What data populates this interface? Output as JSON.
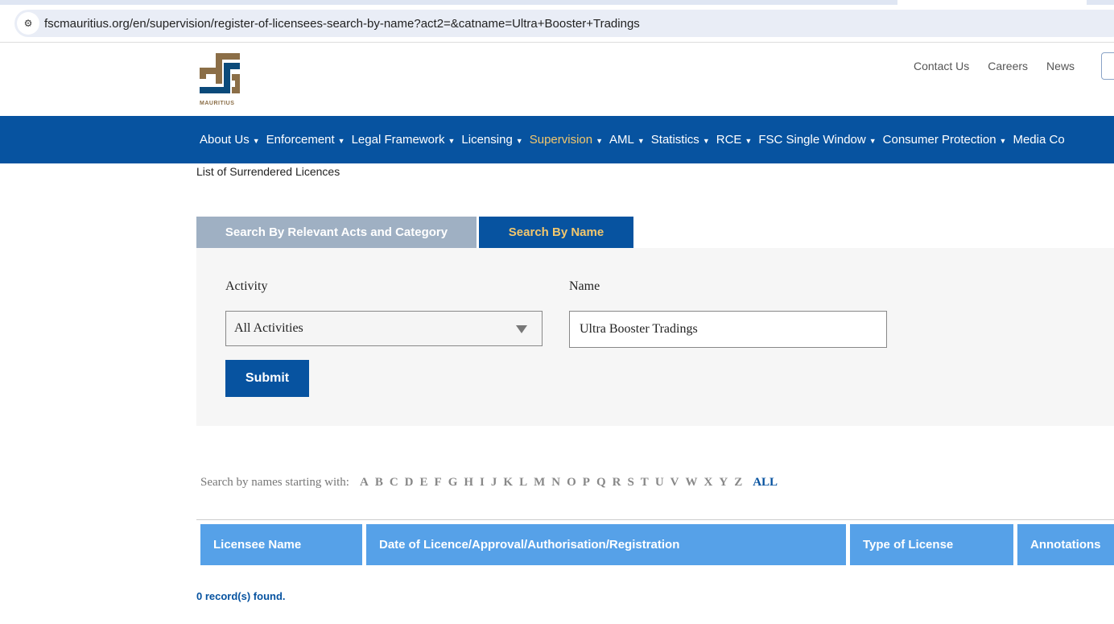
{
  "browser": {
    "url": "fscmauritius.org/en/supervision/register-of-licensees-search-by-name?act2=&catname=Ultra+Booster+Tradings"
  },
  "logo": {
    "text": "MAURITIUS",
    "colors": {
      "brown": "#8b6e47",
      "blue": "#0b4a7a"
    }
  },
  "top_links": [
    "Contact Us",
    "Careers",
    "News"
  ],
  "nav": {
    "items": [
      "About Us",
      "Enforcement",
      "Legal Framework",
      "Licensing",
      "Supervision",
      "AML",
      "Statistics",
      "RCE",
      "FSC Single Window",
      "Consumer Protection",
      "Media Co"
    ],
    "active": "Supervision"
  },
  "breadcrumb_link": "List of Surrendered Licences",
  "tabs": [
    "Search By Relevant Acts and Category",
    "Search By Name"
  ],
  "form": {
    "activity_label": "Activity",
    "activity_value": "All Activities",
    "name_label": "Name",
    "name_value": "Ultra Booster Tradings",
    "submit": "Submit"
  },
  "alpha": {
    "label": "Search by names starting with:",
    "letters": [
      "A",
      "B",
      "C",
      "D",
      "E",
      "F",
      "G",
      "H",
      "I",
      "J",
      "K",
      "L",
      "M",
      "N",
      "O",
      "P",
      "Q",
      "R",
      "S",
      "T",
      "U",
      "V",
      "W",
      "X",
      "Y",
      "Z"
    ],
    "all": "ALL"
  },
  "table": {
    "headers": [
      "Licensee Name",
      "Date of Licence/Approval/Authorisation/Registration",
      "Type of License",
      "Annotations"
    ]
  },
  "result": "0 record(s) found.",
  "colors": {
    "primary": "#0753a0",
    "accent": "#f2c76d",
    "header": "#56a1e8"
  }
}
